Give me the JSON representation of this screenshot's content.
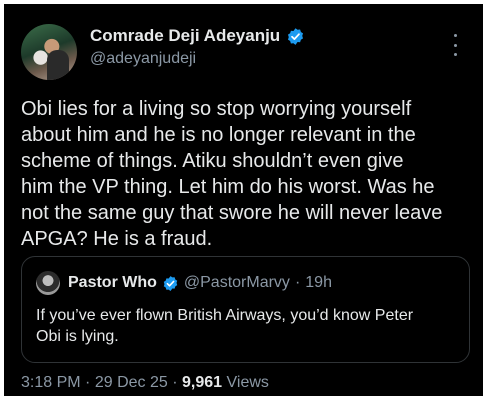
{
  "author": {
    "display_name": "Comrade Deji Adeyanju",
    "handle": "@adeyanjudeji",
    "verified": true
  },
  "tweet": {
    "text": "Obi lies for a living so stop worrying yourself\nabout him and he is no longer relevant in the\nscheme of things. Atiku shouldn’t even give\nhim the VP thing. Let him do his worst. Was he\nnot the same guy that swore he will never leave\nAPGA? He is a fraud."
  },
  "quoted": {
    "display_name": "Pastor Who",
    "handle": "@PastorMarvy",
    "separator": "·",
    "time": "19h",
    "verified": true,
    "text": "If you’ve ever flown British Airways, you’d know Peter\nObi is lying."
  },
  "meta": {
    "time": "3:18 PM",
    "sep1": "·",
    "date": "29 Dec 25",
    "sep2": "·",
    "views_count": "9,961",
    "views_label": "Views"
  },
  "icons": {
    "verified": "verified-badge-icon",
    "more": "more-options-icon"
  },
  "colors": {
    "background": "#000000",
    "text": "#e7e9ea",
    "secondary": "#8b98a5",
    "verified": "#1d9bf0",
    "border": "#2f3336"
  }
}
